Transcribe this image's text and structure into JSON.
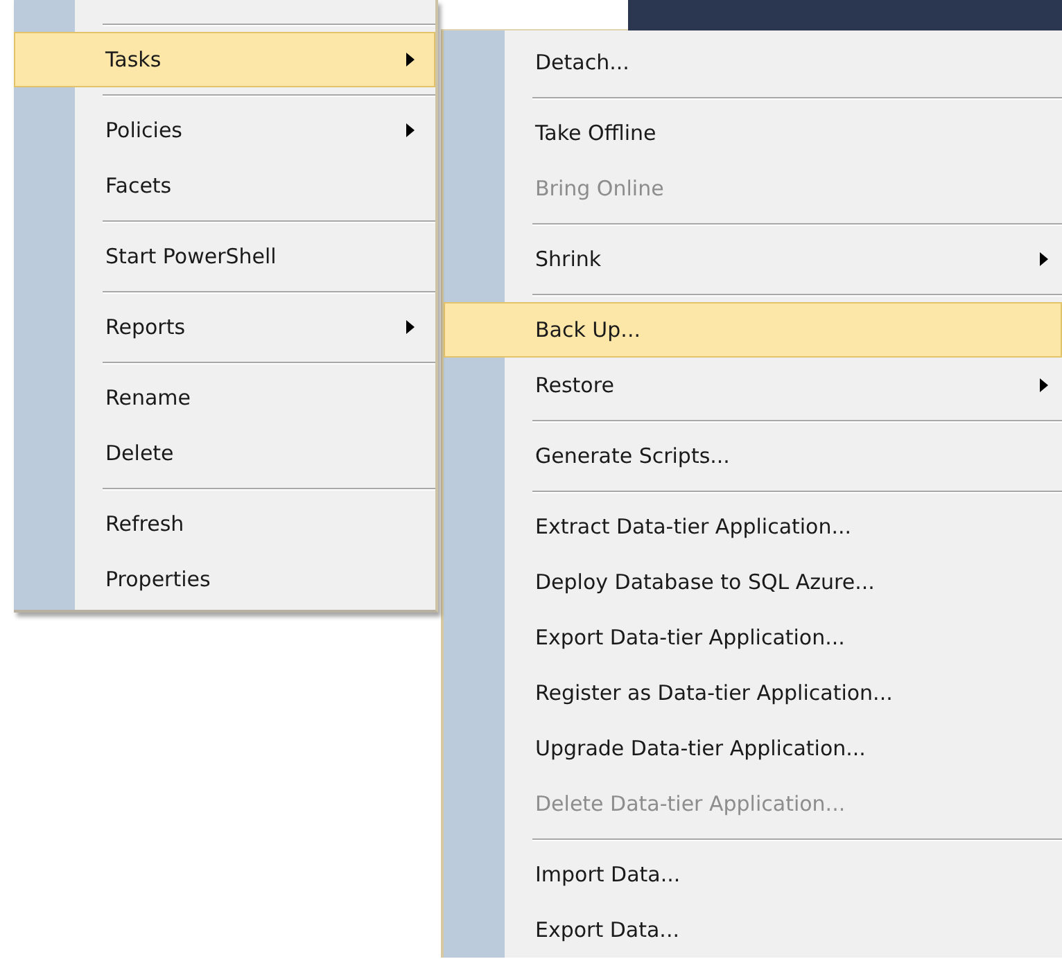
{
  "context_menu": {
    "items": [
      {
        "kind": "separator"
      },
      {
        "kind": "item",
        "label": "Tasks",
        "has_submenu": true,
        "selected": true,
        "disabled": false
      },
      {
        "kind": "separator"
      },
      {
        "kind": "item",
        "label": "Policies",
        "has_submenu": true,
        "selected": false,
        "disabled": false
      },
      {
        "kind": "item",
        "label": "Facets",
        "has_submenu": false,
        "selected": false,
        "disabled": false
      },
      {
        "kind": "separator"
      },
      {
        "kind": "item",
        "label": "Start PowerShell",
        "has_submenu": false,
        "selected": false,
        "disabled": false
      },
      {
        "kind": "separator"
      },
      {
        "kind": "item",
        "label": "Reports",
        "has_submenu": true,
        "selected": false,
        "disabled": false
      },
      {
        "kind": "separator"
      },
      {
        "kind": "item",
        "label": "Rename",
        "has_submenu": false,
        "selected": false,
        "disabled": false
      },
      {
        "kind": "item",
        "label": "Delete",
        "has_submenu": false,
        "selected": false,
        "disabled": false
      },
      {
        "kind": "separator"
      },
      {
        "kind": "item",
        "label": "Refresh",
        "has_submenu": false,
        "selected": false,
        "disabled": false
      },
      {
        "kind": "item",
        "label": "Properties",
        "has_submenu": false,
        "selected": false,
        "disabled": false
      }
    ]
  },
  "submenu": {
    "items": [
      {
        "kind": "item",
        "label": "Detach...",
        "has_submenu": false,
        "selected": false,
        "disabled": false
      },
      {
        "kind": "separator"
      },
      {
        "kind": "item",
        "label": "Take Offline",
        "has_submenu": false,
        "selected": false,
        "disabled": false
      },
      {
        "kind": "item",
        "label": "Bring Online",
        "has_submenu": false,
        "selected": false,
        "disabled": true
      },
      {
        "kind": "separator"
      },
      {
        "kind": "item",
        "label": "Shrink",
        "has_submenu": true,
        "selected": false,
        "disabled": false
      },
      {
        "kind": "separator"
      },
      {
        "kind": "item",
        "label": "Back Up...",
        "has_submenu": false,
        "selected": true,
        "disabled": false
      },
      {
        "kind": "item",
        "label": "Restore",
        "has_submenu": true,
        "selected": false,
        "disabled": false
      },
      {
        "kind": "separator"
      },
      {
        "kind": "item",
        "label": "Generate Scripts...",
        "has_submenu": false,
        "selected": false,
        "disabled": false
      },
      {
        "kind": "separator"
      },
      {
        "kind": "item",
        "label": "Extract Data-tier Application...",
        "has_submenu": false,
        "selected": false,
        "disabled": false
      },
      {
        "kind": "item",
        "label": "Deploy Database to SQL Azure...",
        "has_submenu": false,
        "selected": false,
        "disabled": false
      },
      {
        "kind": "item",
        "label": "Export Data-tier Application...",
        "has_submenu": false,
        "selected": false,
        "disabled": false
      },
      {
        "kind": "item",
        "label": "Register as Data-tier Application...",
        "has_submenu": false,
        "selected": false,
        "disabled": false
      },
      {
        "kind": "item",
        "label": "Upgrade Data-tier Application...",
        "has_submenu": false,
        "selected": false,
        "disabled": false
      },
      {
        "kind": "item",
        "label": "Delete Data-tier Application...",
        "has_submenu": false,
        "selected": false,
        "disabled": true
      },
      {
        "kind": "separator"
      },
      {
        "kind": "item",
        "label": "Import Data...",
        "has_submenu": false,
        "selected": false,
        "disabled": false
      },
      {
        "kind": "item",
        "label": "Export Data...",
        "has_submenu": false,
        "selected": false,
        "disabled": false
      }
    ]
  }
}
